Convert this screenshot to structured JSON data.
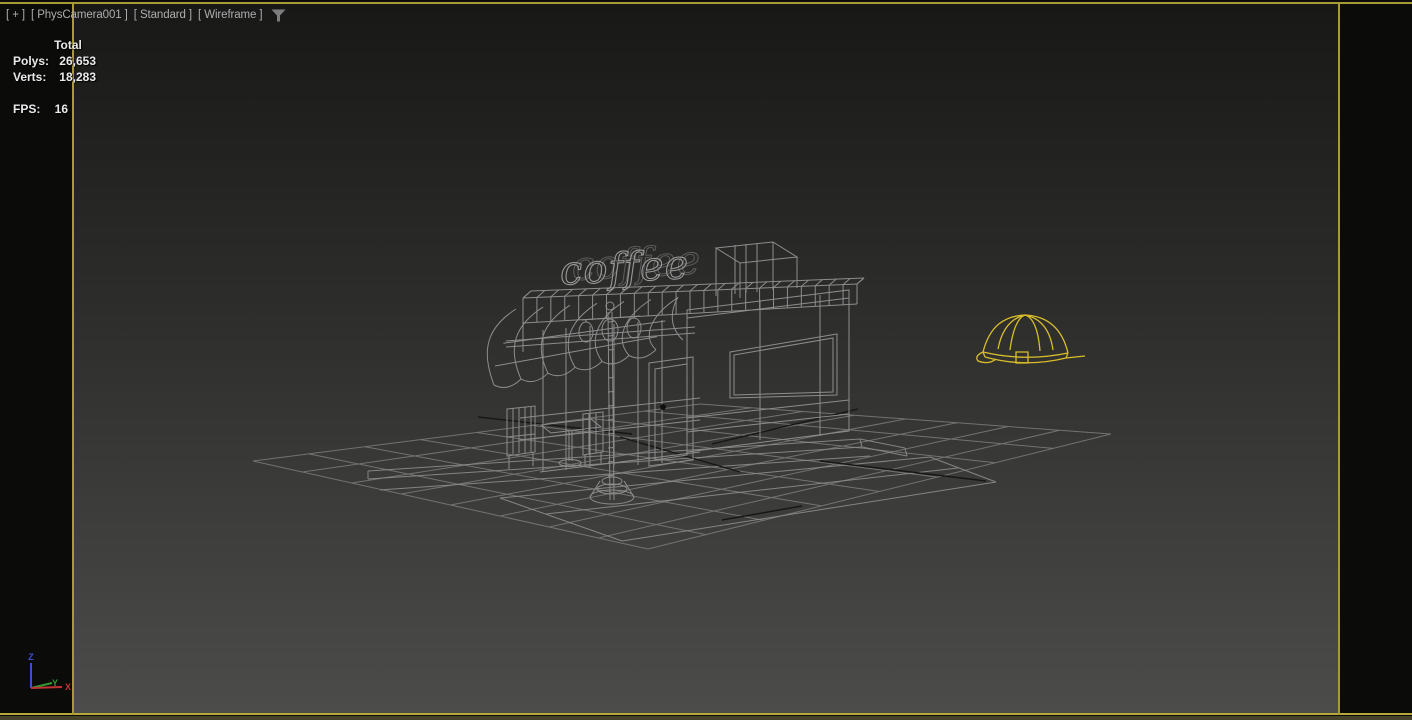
{
  "viewport_label": {
    "pov": "[ + ]",
    "camera": "[ PhysCamera001 ]",
    "style": "[ Standard ]",
    "shading": "[ Wireframe ]"
  },
  "statistics": {
    "header": "Total",
    "polys_label": "Polys:",
    "polys_value": "26,653",
    "verts_label": "Verts:",
    "verts_value": "18,283",
    "fps_label": "FPS:",
    "fps_value": "16"
  },
  "scene": {
    "sign_text": "coffee"
  },
  "axis_gizmo": {
    "x_label": "X",
    "y_label": "Y",
    "z_label": "Z"
  },
  "colors": {
    "safe_frame": "#a89a35",
    "wireframe": "#8d8d8d",
    "wireframe_dark": "#161616",
    "light_wire": "#d9be2a",
    "axis_x": "#c03434",
    "axis_y": "#2f9b2f",
    "axis_z": "#3b4fd8"
  }
}
